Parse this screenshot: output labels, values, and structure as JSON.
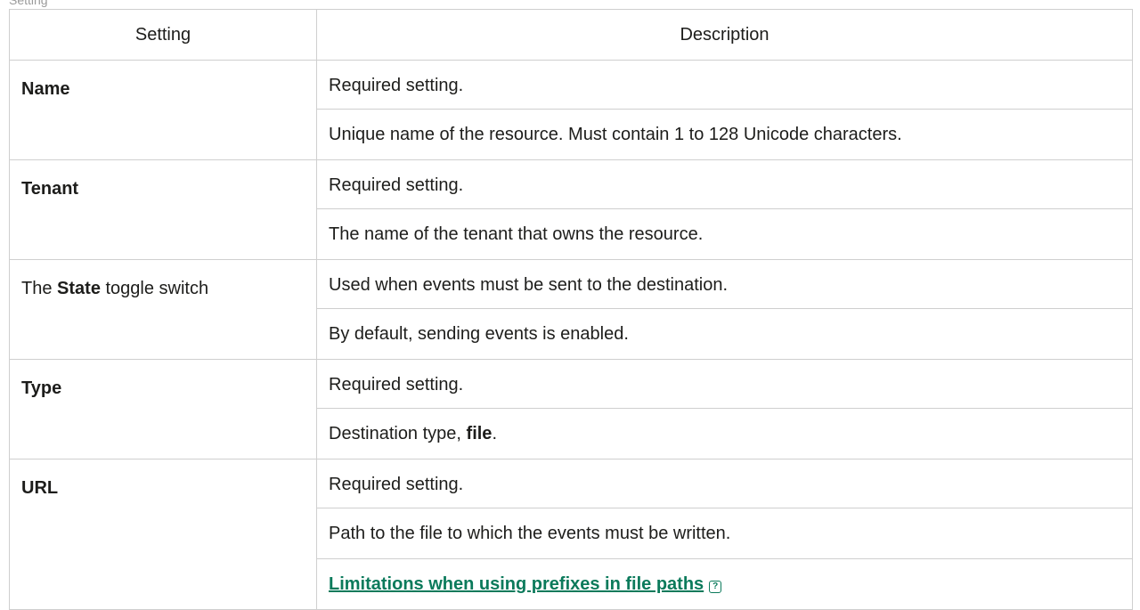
{
  "caption": "Setting",
  "table": {
    "headers": [
      "Setting",
      "Description"
    ],
    "rows": [
      {
        "setting_prefix": "",
        "setting_bold": "Name",
        "setting_suffix": "",
        "lines": [
          {
            "text": "Required setting."
          },
          {
            "text": "Unique name of the resource. Must contain 1 to 128 Unicode characters."
          }
        ]
      },
      {
        "setting_prefix": "",
        "setting_bold": "Tenant",
        "setting_suffix": "",
        "lines": [
          {
            "text": "Required setting."
          },
          {
            "text": "The name of the tenant that owns the resource."
          }
        ]
      },
      {
        "setting_prefix": "The ",
        "setting_bold": "State",
        "setting_suffix": " toggle switch",
        "lines": [
          {
            "text": "Used when events must be sent to the destination."
          },
          {
            "text": "By default, sending events is enabled."
          }
        ]
      },
      {
        "setting_prefix": "",
        "setting_bold": "Type",
        "setting_suffix": "",
        "lines": [
          {
            "text": "Required setting."
          },
          {
            "text": "Destination type, ",
            "bold": "file",
            "after": "."
          }
        ]
      },
      {
        "setting_prefix": "",
        "setting_bold": "URL",
        "setting_suffix": "",
        "lines": [
          {
            "text": "Required setting."
          },
          {
            "text": "Path to the file to which the events must be written."
          },
          {
            "link": "Limitations when using prefixes in file paths",
            "icon": "help-icon"
          }
        ]
      }
    ]
  },
  "colors": {
    "border": "#cfcfcf",
    "link": "#0b7a5b",
    "text": "#1d1d1b"
  }
}
